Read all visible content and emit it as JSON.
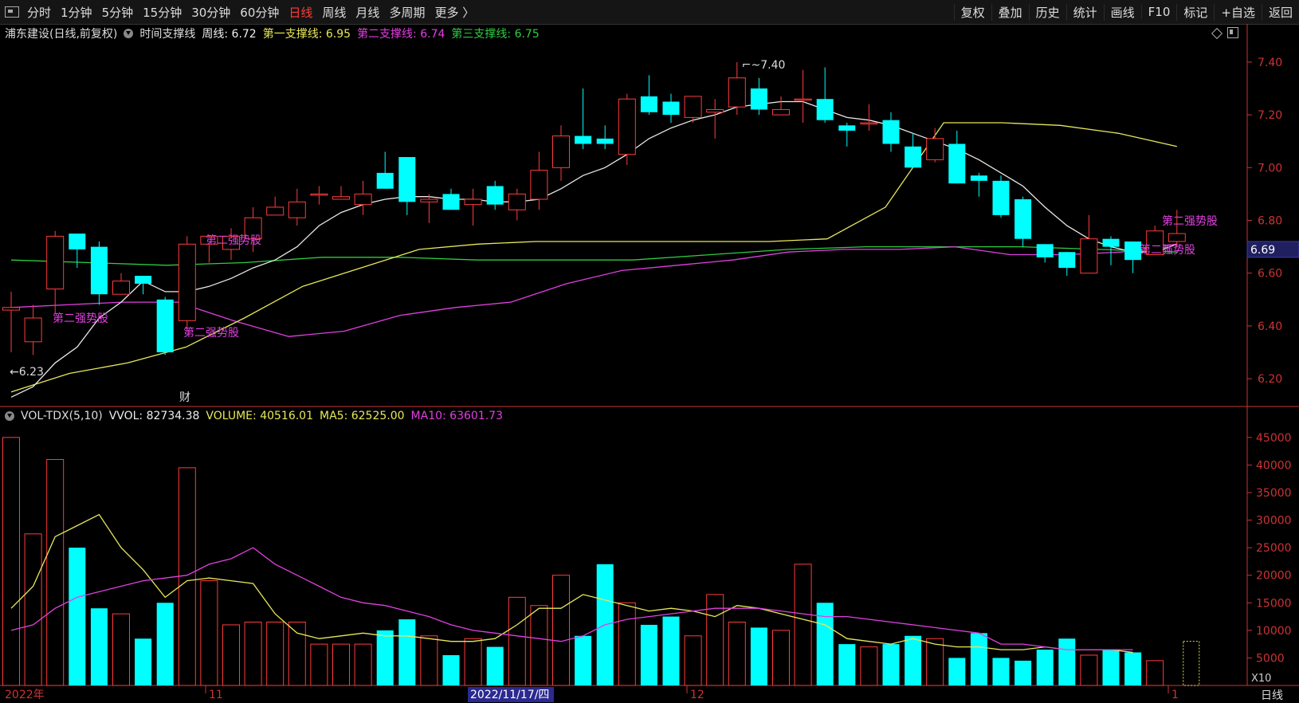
{
  "toolbar": {
    "left_tabs": [
      "分时",
      "1分钟",
      "5分钟",
      "15分钟",
      "30分钟",
      "60分钟",
      "日线",
      "周线",
      "月线",
      "多周期",
      "更多 〉"
    ],
    "active_tab": "日线",
    "right_buttons": [
      "复权",
      "叠加",
      "历史",
      "统计",
      "画线",
      "F10",
      "标记",
      "+自选",
      "返回"
    ]
  },
  "price_header": {
    "stock": "浦东建设(日线,前复权)",
    "indicator": "时间支撑线",
    "weekly": "周线: 6.72",
    "sup1": "第一支撑线: 6.95",
    "sup2": "第二支撑线: 6.74",
    "sup3": "第三支撑线: 6.75"
  },
  "vol_header": {
    "name": "VOL-TDX(5,10)",
    "vvol": "VVOL: 82734.38",
    "volume": "VOLUME: 40516.01",
    "ma5": "MA5: 62525.00",
    "ma10": "MA10: 63601.73"
  },
  "colors": {
    "up": "#ff3d3d",
    "down": "#00ffff",
    "ma_white": "#e8e8e8",
    "yellow": "#e8e85a",
    "magenta": "#e040e0",
    "green": "#2ecc40",
    "axis": "#c33"
  },
  "price_axis": [
    "7.40",
    "7.20",
    "7.00",
    "6.80",
    "6.60",
    "6.40",
    "6.20"
  ],
  "current_price": "6.69",
  "vol_axis": [
    "45000",
    "40000",
    "35000",
    "30000",
    "25000",
    "20000",
    "15000",
    "10000",
    "5000"
  ],
  "vol_unit": "X10",
  "date_labels": [
    "2022年",
    "11",
    "2022/11/17/四",
    "12",
    "1"
  ],
  "bottom_right": "日线",
  "annotations": {
    "high": "7.40",
    "low": "6.23",
    "finance": "财",
    "strong": "第二强势股"
  },
  "chart_data": {
    "type": "candlestick",
    "candles": [
      [
        6.46,
        6.53,
        6.3,
        6.47
      ],
      [
        6.34,
        6.48,
        6.29,
        6.43
      ],
      [
        6.54,
        6.76,
        6.45,
        6.74
      ],
      [
        6.75,
        6.7,
        6.62,
        6.69
      ],
      [
        6.7,
        6.72,
        6.48,
        6.52
      ],
      [
        6.52,
        6.6,
        6.52,
        6.57
      ],
      [
        6.59,
        6.59,
        6.52,
        6.56
      ],
      [
        6.5,
        6.51,
        6.29,
        6.3
      ],
      [
        6.42,
        6.74,
        6.38,
        6.71
      ],
      [
        6.71,
        6.74,
        6.64,
        6.74
      ],
      [
        6.69,
        6.77,
        6.65,
        6.74
      ],
      [
        6.73,
        6.85,
        6.68,
        6.81
      ],
      [
        6.82,
        6.89,
        6.82,
        6.85
      ],
      [
        6.81,
        6.92,
        6.78,
        6.87
      ],
      [
        6.9,
        6.93,
        6.86,
        6.9
      ],
      [
        6.88,
        6.93,
        6.88,
        6.89
      ],
      [
        6.86,
        6.95,
        6.82,
        6.9
      ],
      [
        6.98,
        7.06,
        6.92,
        6.92
      ],
      [
        7.04,
        7.04,
        6.82,
        6.87
      ],
      [
        6.87,
        6.9,
        6.79,
        6.88
      ],
      [
        6.9,
        6.92,
        6.84,
        6.84
      ],
      [
        6.86,
        6.92,
        6.78,
        6.88
      ],
      [
        6.93,
        6.95,
        6.84,
        6.86
      ],
      [
        6.84,
        6.92,
        6.8,
        6.9
      ],
      [
        6.88,
        7.06,
        6.84,
        6.99
      ],
      [
        7.0,
        7.16,
        6.95,
        7.12
      ],
      [
        7.12,
        7.3,
        7.07,
        7.09
      ],
      [
        7.11,
        7.16,
        7.07,
        7.09
      ],
      [
        7.05,
        7.28,
        7.01,
        7.26
      ],
      [
        7.27,
        7.35,
        7.2,
        7.21
      ],
      [
        7.25,
        7.28,
        7.17,
        7.2
      ],
      [
        7.19,
        7.27,
        7.17,
        7.27
      ],
      [
        7.21,
        7.26,
        7.11,
        7.22
      ],
      [
        7.23,
        7.4,
        7.2,
        7.34
      ],
      [
        7.3,
        7.34,
        7.2,
        7.22
      ],
      [
        7.2,
        7.27,
        7.2,
        7.22
      ],
      [
        7.26,
        7.37,
        7.17,
        7.26
      ],
      [
        7.26,
        7.38,
        7.17,
        7.18
      ],
      [
        7.16,
        7.17,
        7.08,
        7.14
      ],
      [
        7.17,
        7.24,
        7.14,
        7.17
      ],
      [
        7.18,
        7.21,
        7.06,
        7.09
      ],
      [
        7.08,
        7.13,
        7.0,
        7.0
      ],
      [
        7.03,
        7.15,
        7.02,
        7.11
      ],
      [
        7.09,
        7.14,
        6.94,
        6.94
      ],
      [
        6.97,
        6.98,
        6.89,
        6.95
      ],
      [
        6.95,
        6.97,
        6.81,
        6.82
      ],
      [
        6.88,
        6.89,
        6.7,
        6.73
      ],
      [
        6.71,
        6.71,
        6.64,
        6.66
      ],
      [
        6.68,
        6.68,
        6.59,
        6.62
      ],
      [
        6.6,
        6.82,
        6.6,
        6.73
      ],
      [
        6.73,
        6.74,
        6.63,
        6.7
      ],
      [
        6.72,
        6.72,
        6.6,
        6.65
      ],
      [
        6.67,
        6.78,
        6.67,
        6.76
      ],
      [
        6.72,
        6.84,
        6.7,
        6.75
      ]
    ],
    "candle_format": "open,high,low,close",
    "ma_white": [
      6.13,
      6.17,
      6.26,
      6.32,
      6.43,
      6.49,
      6.57,
      6.53,
      6.53,
      6.55,
      6.58,
      6.62,
      6.65,
      6.7,
      6.78,
      6.83,
      6.86,
      6.88,
      6.89,
      6.89,
      6.88,
      6.88,
      6.87,
      6.87,
      6.88,
      6.92,
      6.97,
      7.0,
      7.05,
      7.11,
      7.15,
      7.18,
      7.2,
      7.23,
      7.24,
      7.25,
      7.25,
      7.22,
      7.19,
      7.18,
      7.16,
      7.13,
      7.1,
      7.07,
      7.03,
      6.98,
      6.93,
      6.85,
      6.78,
      6.73,
      6.7,
      6.68,
      6.68,
      6.71
    ],
    "yellow": [
      6.15,
      6.22,
      6.26,
      6.32,
      6.43,
      6.55,
      6.62,
      6.69,
      6.71,
      6.72,
      6.72,
      6.72,
      6.72,
      6.72,
      6.73,
      6.85,
      7.17,
      7.17,
      7.16,
      7.13,
      7.08,
      7.02,
      6.95
    ],
    "magenta": [
      6.47,
      6.48,
      6.49,
      6.49,
      6.42,
      6.36,
      6.38,
      6.44,
      6.47,
      6.49,
      6.56,
      6.61,
      6.63,
      6.65,
      6.68,
      6.69,
      6.69,
      6.7,
      6.67,
      6.67,
      6.68,
      6.71
    ],
    "green": [
      6.65,
      6.64,
      6.63,
      6.64,
      6.66,
      6.66,
      6.65,
      6.65,
      6.65,
      6.67,
      6.69,
      6.7,
      6.7,
      6.7,
      6.69,
      6.68
    ],
    "volumes": [
      45000,
      27500,
      41000,
      25000,
      14000,
      13000,
      8500,
      15000,
      39500,
      19000,
      11000,
      11500,
      11500,
      11500,
      7500,
      7500,
      7500,
      10000,
      12000,
      9000,
      5500,
      8500,
      7000,
      16000,
      14500,
      20000,
      9000,
      22000,
      15000,
      11000,
      12500,
      9000,
      16500,
      11500,
      10500,
      10000,
      22000,
      15000,
      7500,
      7000,
      7500,
      9000,
      8500,
      5000,
      9500,
      5000,
      4500,
      6500,
      8500,
      5500,
      6500,
      6000,
      4500
    ],
    "vol_ma5": [
      14000,
      18000,
      27000,
      29000,
      31000,
      25000,
      21000,
      16000,
      19000,
      19500,
      19000,
      18500,
      13000,
      9500,
      8500,
      9000,
      9500,
      9000,
      9000,
      8500,
      8000,
      8000,
      8500,
      11000,
      14000,
      14000,
      16500,
      15500,
      14500,
      13500,
      14000,
      13500,
      12500,
      14500,
      14000,
      13000,
      12000,
      11000,
      8500,
      8000,
      7500,
      8500,
      7500,
      7000,
      7000,
      6500,
      6500,
      7000,
      6500,
      6500,
      6500,
      6000
    ],
    "vol_ma10": [
      10000,
      11000,
      14000,
      16000,
      17000,
      18000,
      19000,
      19500,
      20000,
      22000,
      23000,
      25000,
      22000,
      20000,
      18000,
      16000,
      15000,
      14500,
      13500,
      12500,
      11000,
      10000,
      9500,
      9000,
      8500,
      8000,
      9000,
      11000,
      12000,
      12500,
      13000,
      13500,
      14000,
      14000,
      14000,
      13500,
      13000,
      12500,
      12500,
      12000,
      11500,
      11000,
      10500,
      10000,
      9500,
      7500,
      7500,
      7000,
      6500,
      6500,
      6500,
      6500
    ]
  }
}
